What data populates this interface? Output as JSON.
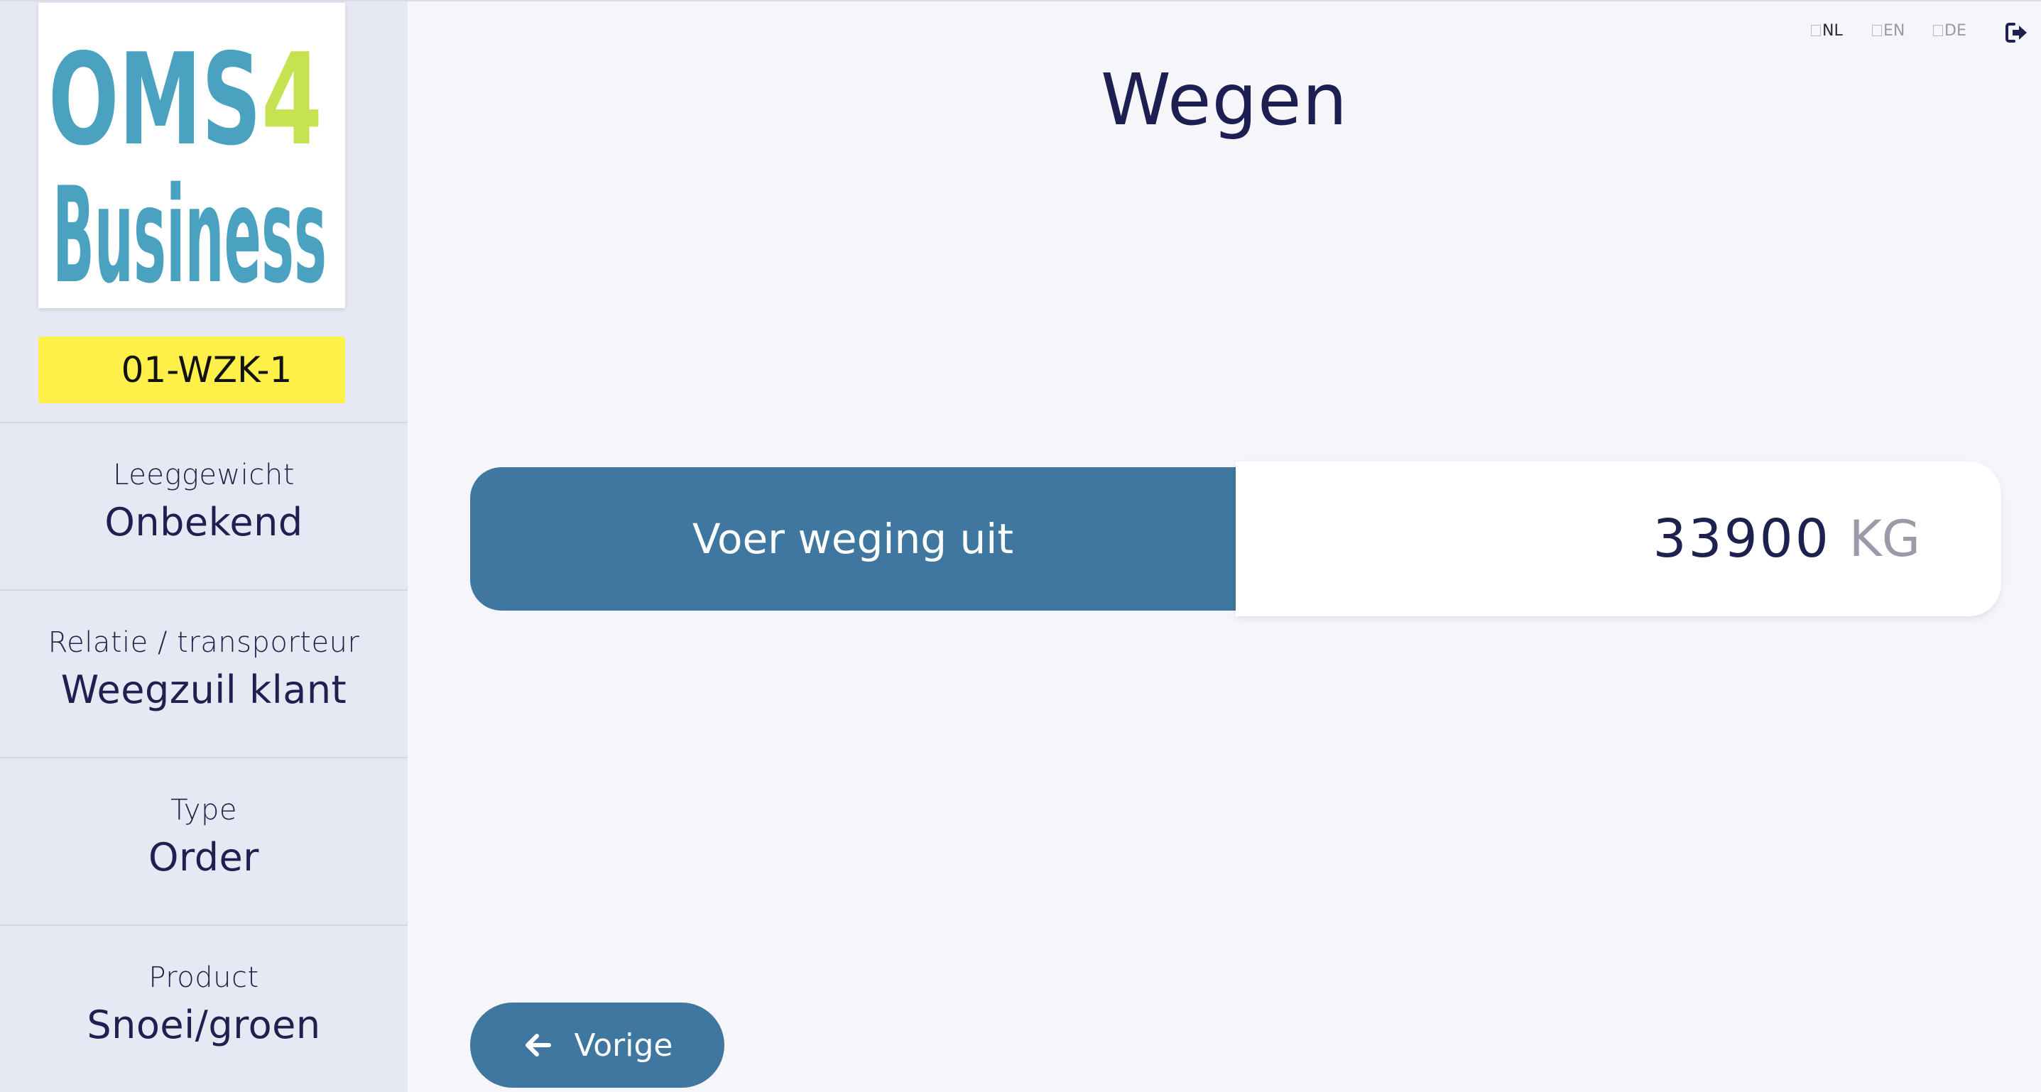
{
  "sidebar": {
    "logo": {
      "line1": "OMS",
      "digit": "4",
      "line2": "Business",
      "colors": {
        "blue": "#4aa2c0",
        "green": "#c6e251"
      }
    },
    "plate": "01-WZK-1",
    "items": [
      {
        "label": "Leeggewicht",
        "value": "Onbekend"
      },
      {
        "label": "Relatie / transporteur",
        "value": "Weegzuil klant"
      },
      {
        "label": "Type",
        "value": "Order"
      },
      {
        "label": "Product",
        "value": "Snoei/groen"
      }
    ]
  },
  "header": {
    "languages": [
      "NL",
      "EN",
      "DE"
    ],
    "logout_icon": "sign-out-icon"
  },
  "main": {
    "title": "Wegen",
    "weigh_button": "Voer weging uit",
    "weight_value": "33900",
    "weight_unit": "KG",
    "back_button": "Vorige",
    "back_icon": "arrow-left-icon"
  },
  "colors": {
    "primary": "#3f77a0",
    "text_dark": "#1e2150",
    "plate_yellow": "#fff04a",
    "sidebar_bg": "#e6e8f3",
    "page_bg": "#f5f5fa"
  }
}
